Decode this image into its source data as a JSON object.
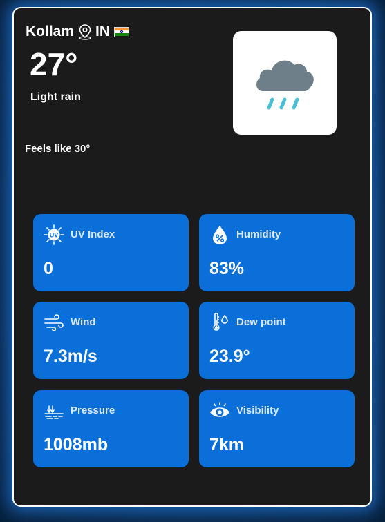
{
  "location": {
    "city": "Kollam",
    "country": "IN",
    "pin_icon": "map-pin-icon",
    "flag_icon": "india-flag-icon"
  },
  "current": {
    "temperature": "27°",
    "condition": "Light rain",
    "feels_like": "Feels like 30°",
    "condition_icon": "rain-cloud-icon"
  },
  "metrics": [
    {
      "label": "UV Index",
      "value": "0",
      "icon": "uv-index-icon"
    },
    {
      "label": "Humidity",
      "value": "83%",
      "icon": "humidity-drop-icon"
    },
    {
      "label": "Wind",
      "value": "7.3m/s",
      "icon": "wind-icon"
    },
    {
      "label": "Dew point",
      "value": "23.9°",
      "icon": "dew-point-thermometer-icon"
    },
    {
      "label": "Pressure",
      "value": "1008mb",
      "icon": "pressure-gauge-icon"
    },
    {
      "label": "Visibility",
      "value": "7km",
      "icon": "eye-icon"
    }
  ],
  "colors": {
    "card_background": "#1b1b1c",
    "tile_background": "#0a6fd8",
    "glow": "#288cff",
    "cloud": "#6e7f8a",
    "rain": "#49bfd6"
  }
}
